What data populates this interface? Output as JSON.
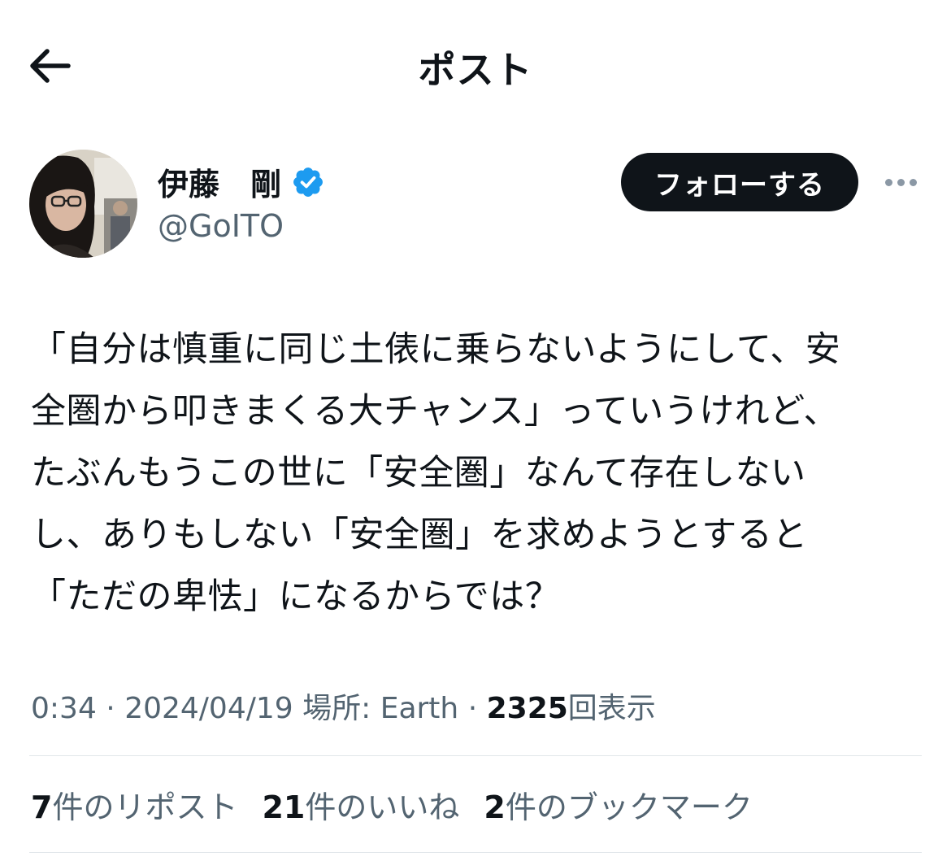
{
  "header": {
    "title": "ポスト",
    "back_icon": "arrow-left-icon"
  },
  "author": {
    "name": "伊藤　剛",
    "handle": "@GoITO",
    "verified": true,
    "verified_color": "#1d9bf0"
  },
  "actions": {
    "follow_label": "フォローする",
    "more_icon": "more-horizontal-icon"
  },
  "tweet": {
    "lines": [
      "「自分は慎重に同じ土俵に乗らないようにして、安",
      "全圏から叩きまくる大チャンス」っていうけれど、",
      "たぶんもうこの世に「安全圏」なんて存在しない",
      "し、ありもしない「安全圏」を求めようとすると",
      "「ただの卑怯」になるからでは？"
    ]
  },
  "meta": {
    "time": "0:34",
    "sep1": " · ",
    "date": "2024/04/19",
    "location": " 場所: Earth",
    "sep2": " · ",
    "views_count": "2325",
    "views_label": "回表示"
  },
  "stats": [
    {
      "count": "7",
      "label": "件のリポスト"
    },
    {
      "count": "21",
      "label": "件のいいね"
    },
    {
      "count": "2",
      "label": "件のブックマーク"
    }
  ],
  "colors": {
    "text": "#0f1419",
    "secondary": "#536471",
    "divider": "#e1e6ea",
    "follow_bg": "#0f1419"
  }
}
